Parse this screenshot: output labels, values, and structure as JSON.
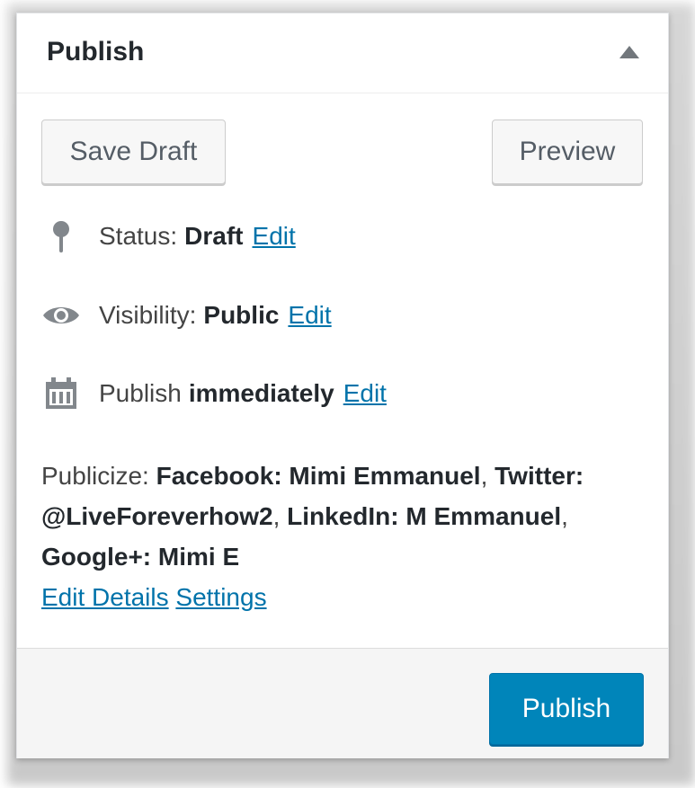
{
  "panel": {
    "title": "Publish"
  },
  "actions": {
    "save_draft_label": "Save Draft",
    "preview_label": "Preview"
  },
  "status": {
    "label": "Status:",
    "value": "Draft",
    "edit_label": "Edit",
    "icon": "pin-icon"
  },
  "visibility": {
    "label": "Visibility:",
    "value": "Public",
    "edit_label": "Edit",
    "icon": "eye-icon"
  },
  "schedule": {
    "label": "Publish",
    "value": "immediately",
    "edit_label": "Edit",
    "icon": "calendar-icon"
  },
  "publicize": {
    "label": "Publicize:",
    "facebook": "Facebook: Mimi Emmanuel",
    "twitter": "Twitter: @LiveForeverhow2",
    "linkedin": "LinkedIn: M Emmanuel",
    "googleplus": "Google+: Mimi E",
    "edit_details_label": "Edit Details",
    "settings_label": "Settings"
  },
  "footer": {
    "publish_label": "Publish"
  },
  "colors": {
    "accent": "#0085ba",
    "link": "#0073aa"
  }
}
